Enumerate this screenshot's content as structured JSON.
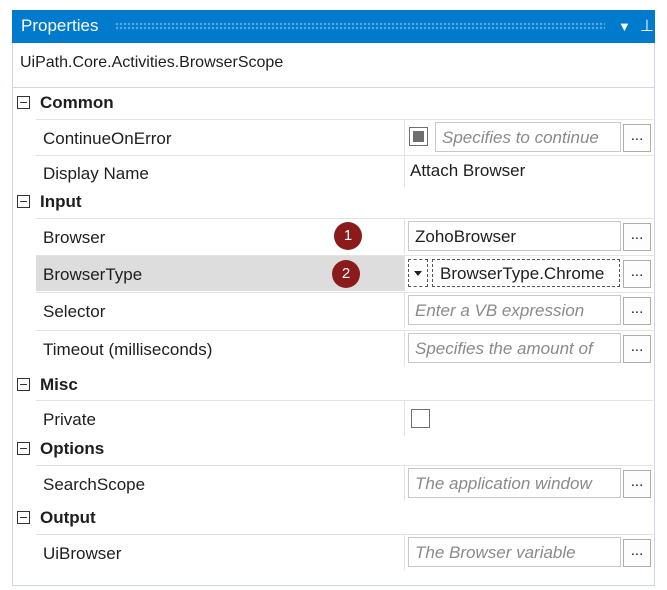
{
  "panel": {
    "title": "Properties",
    "type_name": "UiPath.Core.Activities.BrowserScope"
  },
  "categories": [
    {
      "label": "Common"
    },
    {
      "label": "Input"
    },
    {
      "label": "Misc"
    },
    {
      "label": "Options"
    },
    {
      "label": "Output"
    }
  ],
  "properties": {
    "continue_on_error": {
      "name": "ContinueOnError",
      "placeholder": "Specifies to continue",
      "button": "..."
    },
    "display_name": {
      "name": "Display Name",
      "value": "Attach Browser"
    },
    "browser": {
      "name": "Browser",
      "value": "ZohoBrowser",
      "button": "...",
      "badge": "1"
    },
    "browser_type": {
      "name": "BrowserType",
      "value": "BrowserType.Chrome",
      "button": "...",
      "badge": "2"
    },
    "selector": {
      "name": "Selector",
      "placeholder": "Enter a VB expression",
      "button": "..."
    },
    "timeout": {
      "name": "Timeout (milliseconds)",
      "placeholder": "Specifies the amount of",
      "button": "..."
    },
    "private": {
      "name": "Private"
    },
    "search_scope": {
      "name": "SearchScope",
      "placeholder": "The application window",
      "button": "..."
    },
    "ui_browser": {
      "name": "UiBrowser",
      "placeholder": "The Browser variable",
      "button": "..."
    }
  },
  "colors": {
    "titlebar": "#007acc",
    "badge": "#8b1a1a",
    "selected_row": "#dddddd"
  }
}
